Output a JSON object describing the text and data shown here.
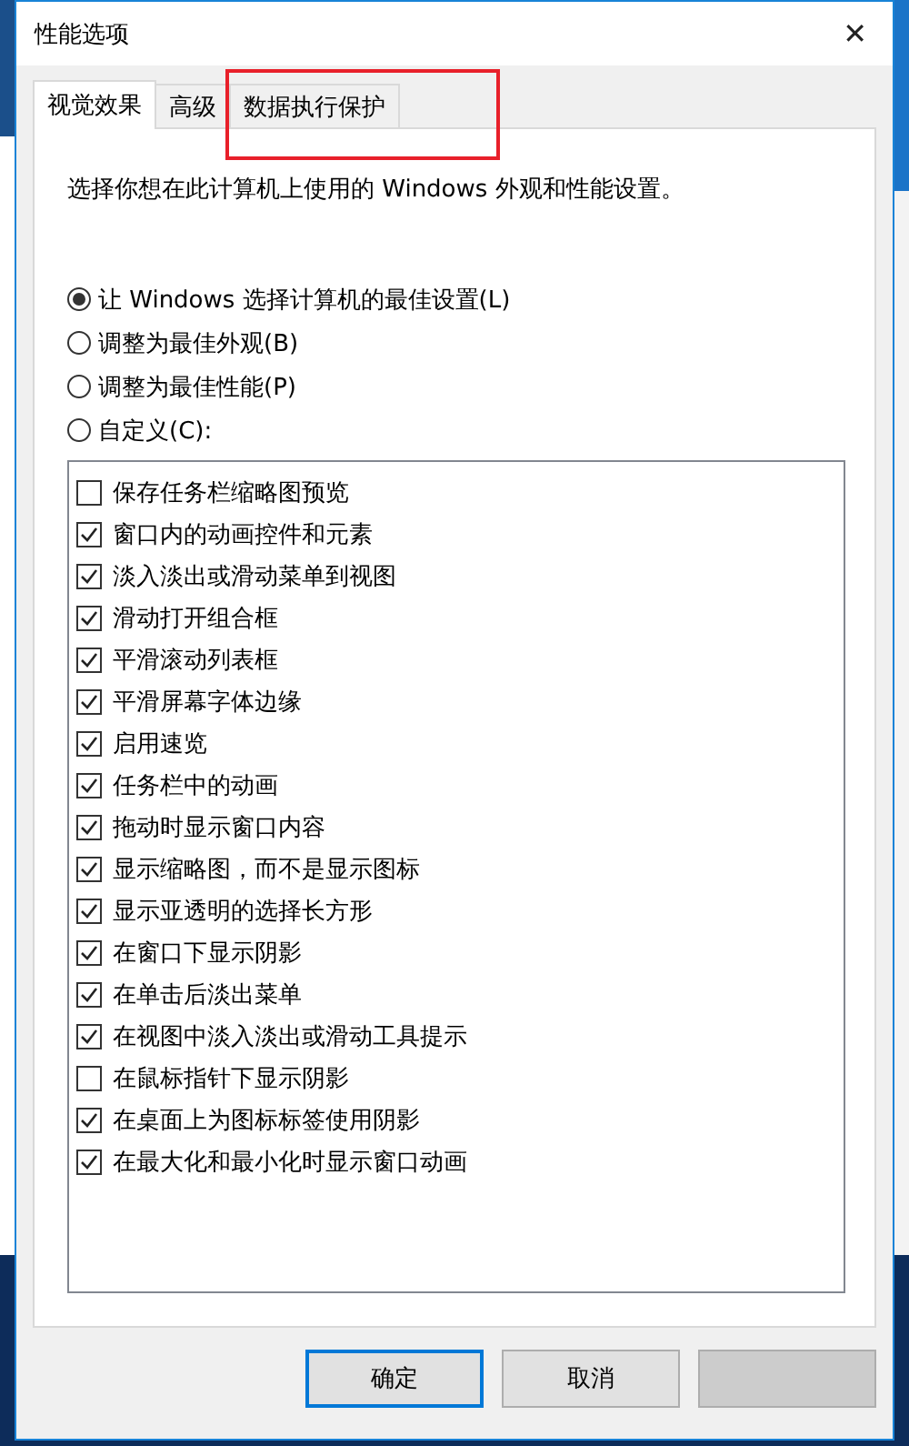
{
  "window": {
    "title": "性能选项",
    "close": "✕"
  },
  "tabs": [
    {
      "label": "视觉效果",
      "selected": true
    },
    {
      "label": "高级",
      "selected": false
    },
    {
      "label": "数据执行保护",
      "selected": false,
      "highlighted": true
    }
  ],
  "description": "选择你想在此计算机上使用的 Windows 外观和性能设置。",
  "options": [
    {
      "label": "让 Windows 选择计算机的最佳设置(L)",
      "selected": true
    },
    {
      "label": "调整为最佳外观(B)",
      "selected": false
    },
    {
      "label": "调整为最佳性能(P)",
      "selected": false
    },
    {
      "label": "自定义(C):",
      "selected": false
    }
  ],
  "effects": [
    {
      "label": "保存任务栏缩略图预览",
      "checked": false
    },
    {
      "label": "窗口内的动画控件和元素",
      "checked": true
    },
    {
      "label": "淡入淡出或滑动菜单到视图",
      "checked": true
    },
    {
      "label": "滑动打开组合框",
      "checked": true
    },
    {
      "label": "平滑滚动列表框",
      "checked": true
    },
    {
      "label": "平滑屏幕字体边缘",
      "checked": true
    },
    {
      "label": "启用速览",
      "checked": true
    },
    {
      "label": "任务栏中的动画",
      "checked": true
    },
    {
      "label": "拖动时显示窗口内容",
      "checked": true
    },
    {
      "label": "显示缩略图，而不是显示图标",
      "checked": true
    },
    {
      "label": "显示亚透明的选择长方形",
      "checked": true
    },
    {
      "label": "在窗口下显示阴影",
      "checked": true
    },
    {
      "label": "在单击后淡出菜单",
      "checked": true
    },
    {
      "label": "在视图中淡入淡出或滑动工具提示",
      "checked": true
    },
    {
      "label": "在鼠标指针下显示阴影",
      "checked": false
    },
    {
      "label": "在桌面上为图标标签使用阴影",
      "checked": true
    },
    {
      "label": "在最大化和最小化时显示窗口动画",
      "checked": true
    }
  ],
  "buttons": [
    {
      "label": "确定",
      "default": true,
      "disabled": false
    },
    {
      "label": "取消",
      "default": false,
      "disabled": false
    },
    {
      "default": false,
      "disabled": true
    }
  ]
}
